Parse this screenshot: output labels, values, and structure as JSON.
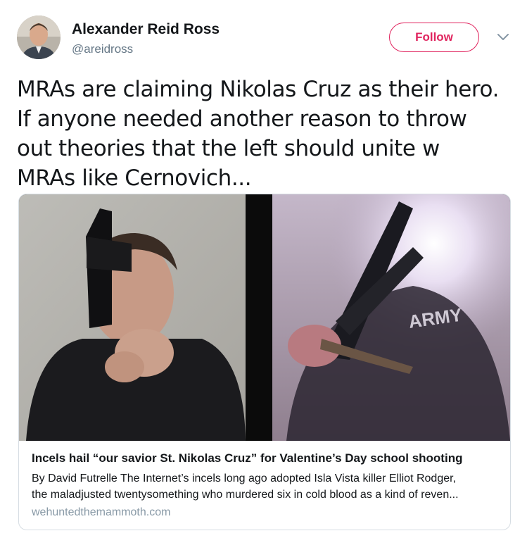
{
  "author": {
    "name": "Alexander Reid Ross",
    "handle": "@areidross"
  },
  "follow_label": "Follow",
  "tweet_lines": [
    "MRAs are claiming Nikolas Cruz as their hero.",
    "If anyone needed another reason to throw",
    "out theories that the left should unite w",
    "MRAs like Cernovich..."
  ],
  "card": {
    "title": "Incels hail “our savior St. Nikolas Cruz” for Valentine’s Day school shooting",
    "description_lines": [
      "By David Futrelle The Internet’s incels long ago adopted Isla Vista killer Elliot Rodger,",
      "the maladjusted twentysomething who murdered six in cold blood as a kind of reven..."
    ],
    "domain": "wehuntedthemammoth.com",
    "image_text": "ARMY"
  },
  "colors": {
    "follow_accent": "#e0245e",
    "handle_gray": "#657786",
    "domain_gray": "#8899a6"
  },
  "icons": {
    "caret": "chevron-down-icon"
  }
}
